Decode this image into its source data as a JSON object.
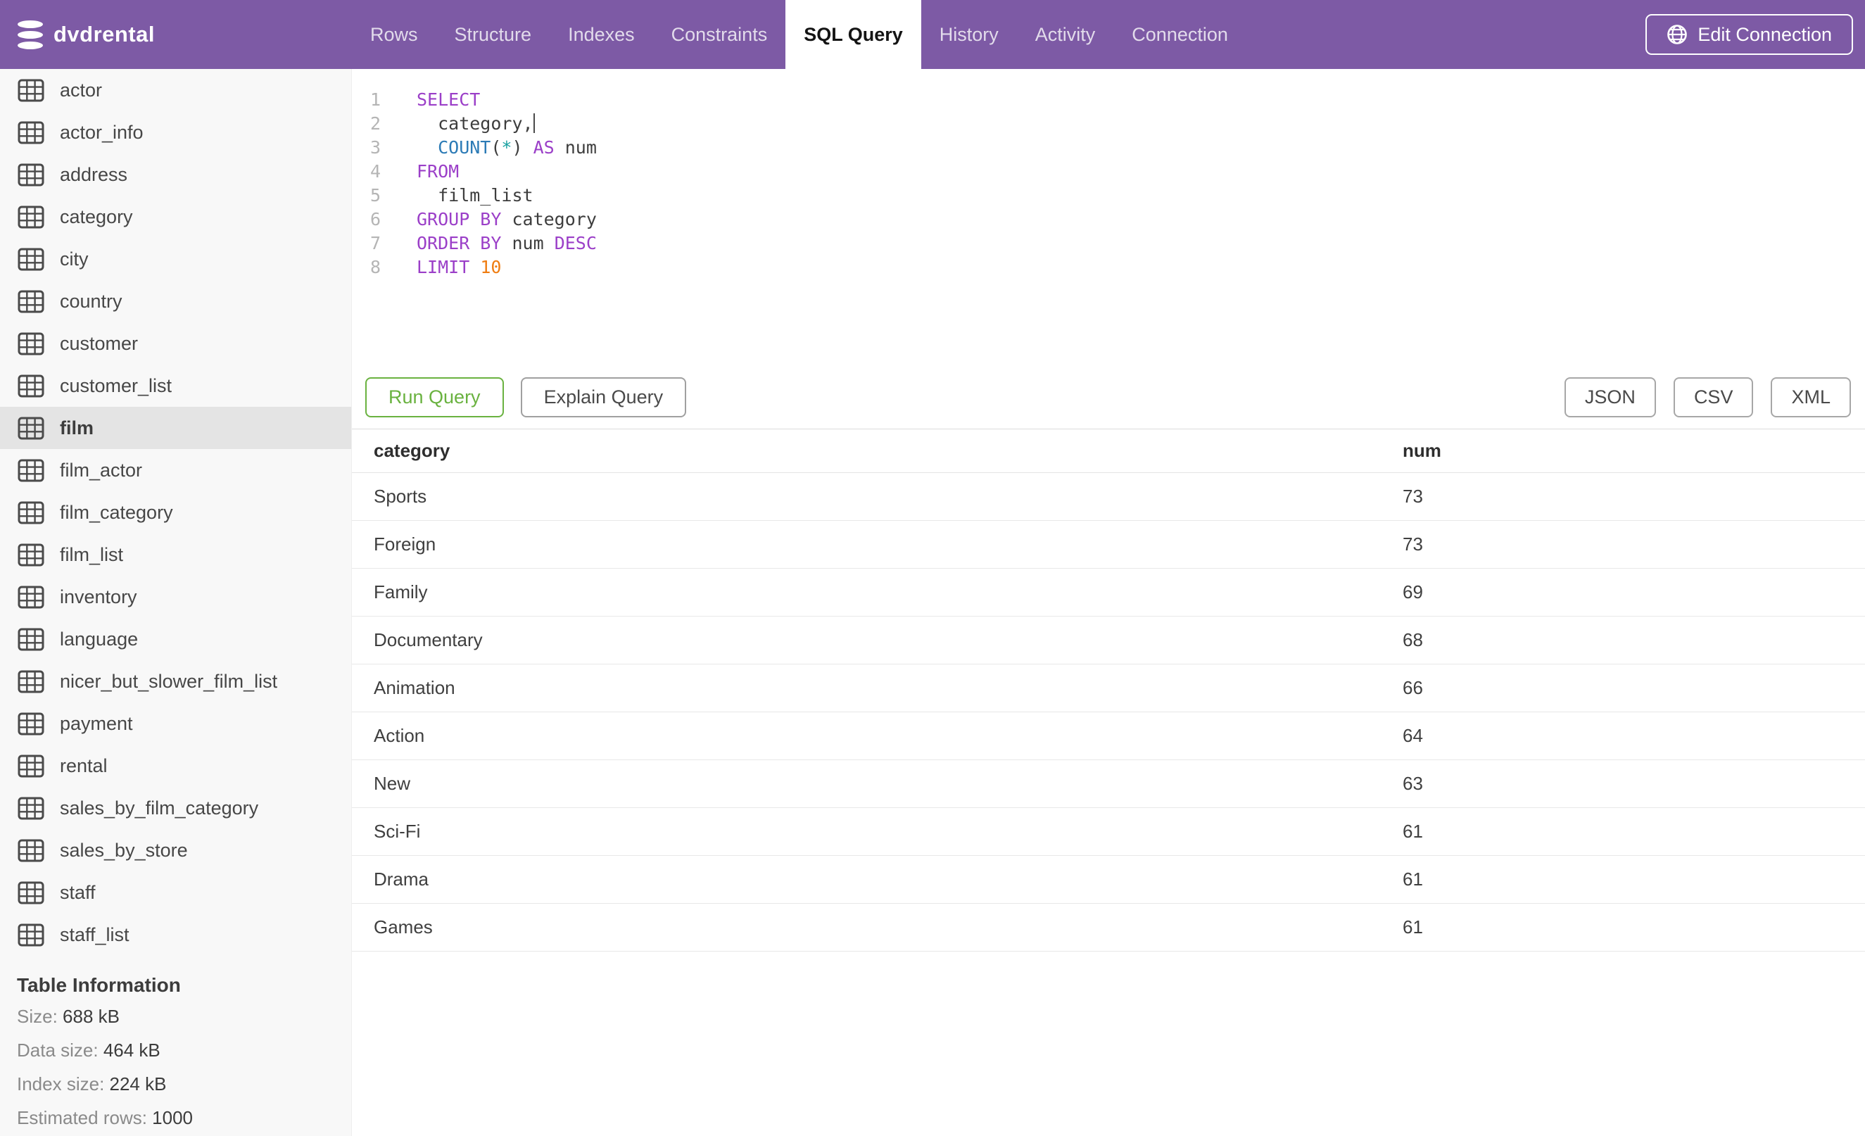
{
  "app": {
    "title": "dvdrental",
    "header_bg": "#7d5aa5",
    "accent_green": "#6ab240",
    "keyword_purple": "#9b3fc8",
    "function_blue": "#2c7bb6",
    "number_orange": "#ef7d12"
  },
  "nav": {
    "tabs": [
      {
        "label": "Rows",
        "active": false
      },
      {
        "label": "Structure",
        "active": false
      },
      {
        "label": "Indexes",
        "active": false
      },
      {
        "label": "Constraints",
        "active": false
      },
      {
        "label": "SQL Query",
        "active": true
      },
      {
        "label": "History",
        "active": false
      },
      {
        "label": "Activity",
        "active": false
      },
      {
        "label": "Connection",
        "active": false
      }
    ],
    "edit_connection_label": "Edit Connection"
  },
  "sidebar": {
    "tables": [
      {
        "name": "actor",
        "selected": false
      },
      {
        "name": "actor_info",
        "selected": false
      },
      {
        "name": "address",
        "selected": false
      },
      {
        "name": "category",
        "selected": false
      },
      {
        "name": "city",
        "selected": false
      },
      {
        "name": "country",
        "selected": false
      },
      {
        "name": "customer",
        "selected": false
      },
      {
        "name": "customer_list",
        "selected": false
      },
      {
        "name": "film",
        "selected": true
      },
      {
        "name": "film_actor",
        "selected": false
      },
      {
        "name": "film_category",
        "selected": false
      },
      {
        "name": "film_list",
        "selected": false
      },
      {
        "name": "inventory",
        "selected": false
      },
      {
        "name": "language",
        "selected": false
      },
      {
        "name": "nicer_but_slower_film_list",
        "selected": false
      },
      {
        "name": "payment",
        "selected": false
      },
      {
        "name": "rental",
        "selected": false
      },
      {
        "name": "sales_by_film_category",
        "selected": false
      },
      {
        "name": "sales_by_store",
        "selected": false
      },
      {
        "name": "staff",
        "selected": false
      },
      {
        "name": "staff_list",
        "selected": false
      }
    ],
    "table_info": {
      "heading": "Table Information",
      "rows": [
        {
          "label": "Size:",
          "value": "688 kB"
        },
        {
          "label": "Data size:",
          "value": "464 kB"
        },
        {
          "label": "Index size:",
          "value": "224 kB"
        },
        {
          "label": "Estimated rows:",
          "value": "1000"
        }
      ]
    }
  },
  "editor": {
    "lines": [
      {
        "n": "1",
        "cursor": false,
        "tokens": [
          {
            "t": "kw",
            "v": "SELECT"
          }
        ]
      },
      {
        "n": "2",
        "cursor": true,
        "tokens": [
          {
            "t": "id",
            "v": "  category"
          },
          {
            "t": "punc",
            "v": ","
          }
        ]
      },
      {
        "n": "3",
        "cursor": false,
        "tokens": [
          {
            "t": "fn",
            "v": "  COUNT"
          },
          {
            "t": "punc",
            "v": "("
          },
          {
            "t": "star",
            "v": "*"
          },
          {
            "t": "punc",
            "v": ")"
          },
          {
            "t": "kw",
            "v": " AS"
          },
          {
            "t": "id",
            "v": " num"
          }
        ]
      },
      {
        "n": "4",
        "cursor": false,
        "tokens": [
          {
            "t": "kw",
            "v": "FROM"
          }
        ]
      },
      {
        "n": "5",
        "cursor": false,
        "tokens": [
          {
            "t": "id",
            "v": "  film_list"
          }
        ]
      },
      {
        "n": "6",
        "cursor": false,
        "tokens": [
          {
            "t": "kw",
            "v": "GROUP BY"
          },
          {
            "t": "id",
            "v": " category"
          }
        ]
      },
      {
        "n": "7",
        "cursor": false,
        "tokens": [
          {
            "t": "kw",
            "v": "ORDER BY"
          },
          {
            "t": "id",
            "v": " num"
          },
          {
            "t": "kw",
            "v": " DESC"
          }
        ]
      },
      {
        "n": "8",
        "cursor": false,
        "tokens": [
          {
            "t": "kw",
            "v": "LIMIT"
          },
          {
            "t": "num",
            "v": " 10"
          }
        ]
      }
    ]
  },
  "actions": {
    "run_label": "Run Query",
    "explain_label": "Explain Query",
    "export_buttons": [
      "JSON",
      "CSV",
      "XML"
    ]
  },
  "results": {
    "columns": [
      "category",
      "num"
    ],
    "rows": [
      {
        "category": "Sports",
        "num": "73"
      },
      {
        "category": "Foreign",
        "num": "73"
      },
      {
        "category": "Family",
        "num": "69"
      },
      {
        "category": "Documentary",
        "num": "68"
      },
      {
        "category": "Animation",
        "num": "66"
      },
      {
        "category": "Action",
        "num": "64"
      },
      {
        "category": "New",
        "num": "63"
      },
      {
        "category": "Sci-Fi",
        "num": "61"
      },
      {
        "category": "Drama",
        "num": "61"
      },
      {
        "category": "Games",
        "num": "61"
      }
    ]
  }
}
